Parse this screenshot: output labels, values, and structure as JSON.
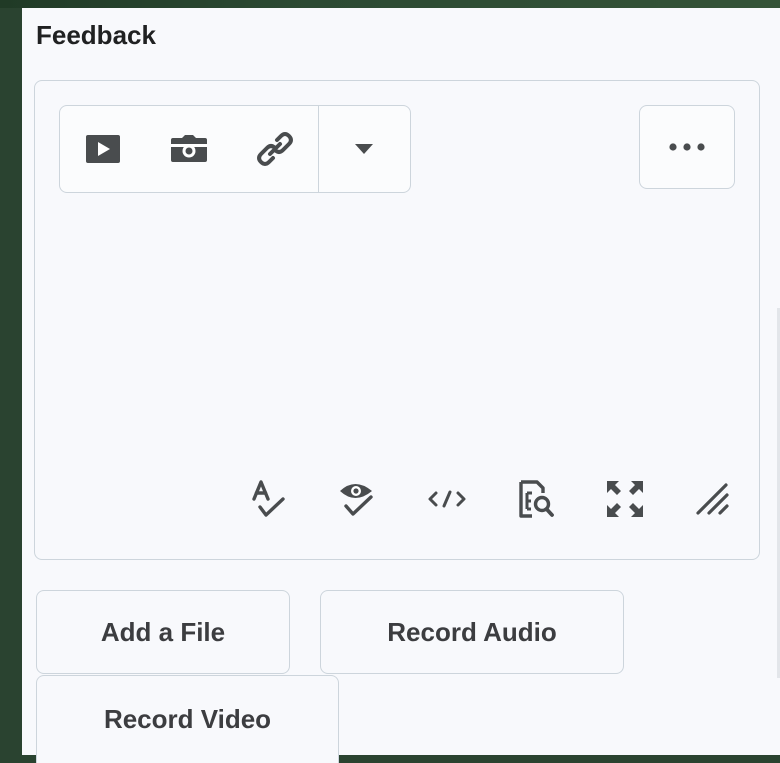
{
  "feedback": {
    "title": "Feedback"
  },
  "toolbar": {
    "icons": [
      "video-play-icon",
      "camera-icon",
      "link-icon",
      "dropdown-caret-icon"
    ],
    "more_icon": "more-options-icon"
  },
  "status_bar": {
    "icons": [
      "spellcheck-icon",
      "accessibility-check-icon",
      "source-code-icon",
      "preview-icon",
      "fullscreen-icon",
      "resize-handle-icon"
    ]
  },
  "actions": {
    "add_file": "Add a File",
    "record_audio": "Record Audio",
    "record_video": "Record Video"
  },
  "colors": {
    "icon": "#494c4e",
    "border": "#cdd5dc",
    "panel_bg": "#f8f9fc",
    "page_bg": "#2a4330"
  }
}
